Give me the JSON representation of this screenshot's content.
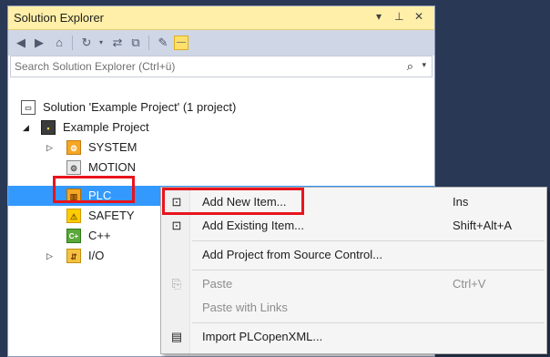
{
  "panel": {
    "title": "Solution Explorer",
    "title_buttons": [
      "▾",
      "⊥",
      "✕"
    ]
  },
  "toolbar": {
    "icons": [
      "back-icon",
      "forward-icon",
      "home-icon",
      "sync-icon",
      "refresh-icon",
      "collapse-all-icon",
      "properties-icon",
      "pin-icon"
    ]
  },
  "search": {
    "placeholder": "Search Solution Explorer (Ctrl+ü)",
    "value": ""
  },
  "tree": {
    "solution": "Solution 'Example Project' (1 project)",
    "project": "Example Project",
    "items": [
      {
        "label": "SYSTEM",
        "icon": "system-icon",
        "expander": "▷"
      },
      {
        "label": "MOTION",
        "icon": "motion-icon",
        "expander": ""
      },
      {
        "label": "PLC",
        "icon": "plc-icon",
        "expander": "",
        "selected": true
      },
      {
        "label": "SAFETY",
        "icon": "safety-icon",
        "expander": ""
      },
      {
        "label": "C++",
        "icon": "cpp-icon",
        "expander": ""
      },
      {
        "label": "I/O",
        "icon": "io-icon",
        "expander": "▷"
      }
    ]
  },
  "context_menu": {
    "items": [
      {
        "label": "Add New Item...",
        "shortcut": "Ins",
        "icon": "add-new-item-icon",
        "enabled": true,
        "highlighted": true
      },
      {
        "label": "Add Existing Item...",
        "shortcut": "Shift+Alt+A",
        "icon": "add-existing-item-icon",
        "enabled": true
      },
      {
        "label": "Add Project from Source Control...",
        "shortcut": "",
        "icon": "",
        "enabled": true
      },
      {
        "label": "Paste",
        "shortcut": "Ctrl+V",
        "icon": "paste-icon",
        "enabled": false
      },
      {
        "label": "Paste with Links",
        "shortcut": "",
        "icon": "",
        "enabled": false
      },
      {
        "label": "Import PLCopenXML...",
        "shortcut": "",
        "icon": "import-xml-icon",
        "enabled": true
      }
    ]
  },
  "colors": {
    "titlebar": "#ffefa8",
    "selection": "#3399ff",
    "highlight_box": "#e8141c",
    "background": "#293955"
  }
}
